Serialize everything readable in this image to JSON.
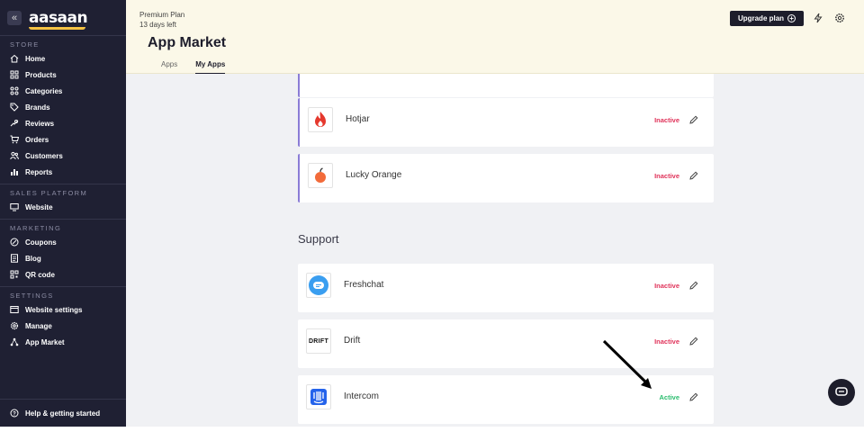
{
  "sidebar": {
    "logo": "aasaan",
    "collapse_icon": "«",
    "sections": {
      "store": "STORE",
      "sales_platform": "SALES PLATFORM",
      "marketing": "MARKETING",
      "settings": "SETTINGS"
    },
    "items": {
      "home": "Home",
      "products": "Products",
      "categories": "Categories",
      "brands": "Brands",
      "reviews": "Reviews",
      "orders": "Orders",
      "customers": "Customers",
      "reports": "Reports",
      "website": "Website",
      "coupons": "Coupons",
      "blog": "Blog",
      "qr_code": "QR code",
      "website_settings": "Website settings",
      "manage": "Manage",
      "app_market": "App Market"
    },
    "help": "Help & getting started"
  },
  "header": {
    "plan_name": "Premium Plan",
    "plan_days": "13 days left",
    "title": "App Market",
    "tabs": [
      "Apps",
      "My Apps"
    ],
    "active_tab": "My Apps",
    "upgrade_label": "Upgrade plan"
  },
  "apps": {
    "hotjar": {
      "name": "Hotjar",
      "status": "Inactive"
    },
    "lucky_orange": {
      "name": "Lucky Orange",
      "status": "Inactive"
    },
    "support_heading": "Support",
    "freshchat": {
      "name": "Freshchat",
      "status": "Inactive"
    },
    "drift": {
      "name": "Drift",
      "status": "Inactive",
      "logo_text": "DRIFT"
    },
    "intercom": {
      "name": "Intercom",
      "status": "Active"
    }
  },
  "colors": {
    "sidebar_bg": "#1f2033",
    "header_bg": "#fbf8e8",
    "inactive": "#e0335a",
    "active": "#2bbd6e",
    "accent": "#8a7cd6"
  }
}
